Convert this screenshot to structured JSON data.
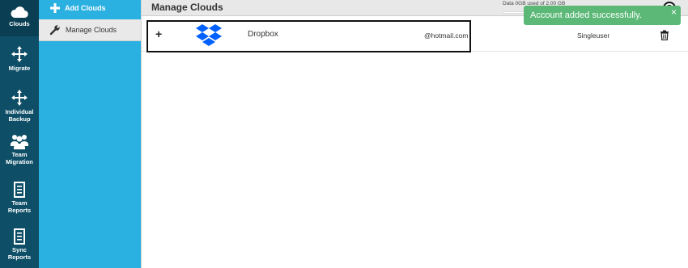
{
  "rail": {
    "items": [
      {
        "label": "Clouds",
        "icon": "cloud-icon",
        "active": true
      },
      {
        "label": "Migrate",
        "icon": "arrows-move-icon"
      },
      {
        "label": "Individual Backup",
        "icon": "arrows-move-icon"
      },
      {
        "label": "Team Migration",
        "icon": "team-icon"
      },
      {
        "label": "Team Reports",
        "icon": "report-icon"
      },
      {
        "label": "Sync Reports",
        "icon": "report-icon"
      }
    ]
  },
  "submenu": {
    "add_clouds": "Add Clouds",
    "manage_clouds": "Manage Clouds"
  },
  "header": {
    "title": "Manage Clouds",
    "usage_text": "Data 0GB used of 2.00 GB",
    "usage_fraction": 0.0
  },
  "clouds": [
    {
      "provider": "Dropbox",
      "email": "@hotmail.com",
      "type": "Singleuser"
    }
  ],
  "toast": {
    "message": "Account added successfully.",
    "close": "×"
  },
  "colors": {
    "rail": "#0e4f67",
    "submenu": "#2ab0e1",
    "toast": "#5bb877",
    "dropbox": "#0061fe"
  }
}
